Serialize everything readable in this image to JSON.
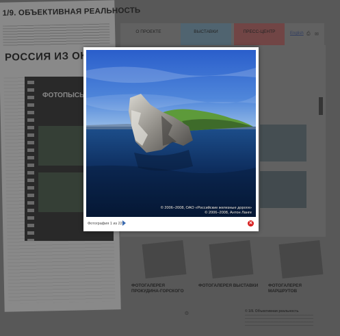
{
  "newspaper": {
    "header": "1/9. ОБЪЕКТИВНАЯ РЕАЛЬНОСТЬ",
    "headline": "РОССИЯ ИЗ ОКНА ПОЕЗДА",
    "film_label": "ФОТОПЫСЬ"
  },
  "nav": {
    "about": "О ПРОЕКТЕ",
    "exhibition": "ВЫСТАВКИ",
    "press": "ПРЕСС-ЦЕНТР",
    "language": "English",
    "icon1": "print-icon",
    "icon2": "mail-icon"
  },
  "galleries": [
    {
      "label": "ФОТОГАЛЕРЕЯ ПРОКУДИНА-ГОРСКОГО"
    },
    {
      "label": "ФОТОГАЛЕРЕЯ ВЫСТАВКИ"
    },
    {
      "label": "ФОТОГАЛЕРЕЯ МАРШРУТОВ"
    }
  ],
  "footer": {
    "title": "© 1/9. Объективная реальность"
  },
  "lightbox": {
    "credit_line1": "© 2006–2008, ОАО «Российские железные дороги»",
    "credit_line2": "© 2006–2008, Антон Ланге",
    "counter": "Фотография 1 из 22",
    "next_icon": "play-icon",
    "close_icon": "close-icon"
  },
  "colors": {
    "sky_top": "#2d63c9",
    "water": "#0b2a57",
    "grass": "#5e9a3a",
    "close": "#d81e1e",
    "accent": "#3a6ab0"
  }
}
